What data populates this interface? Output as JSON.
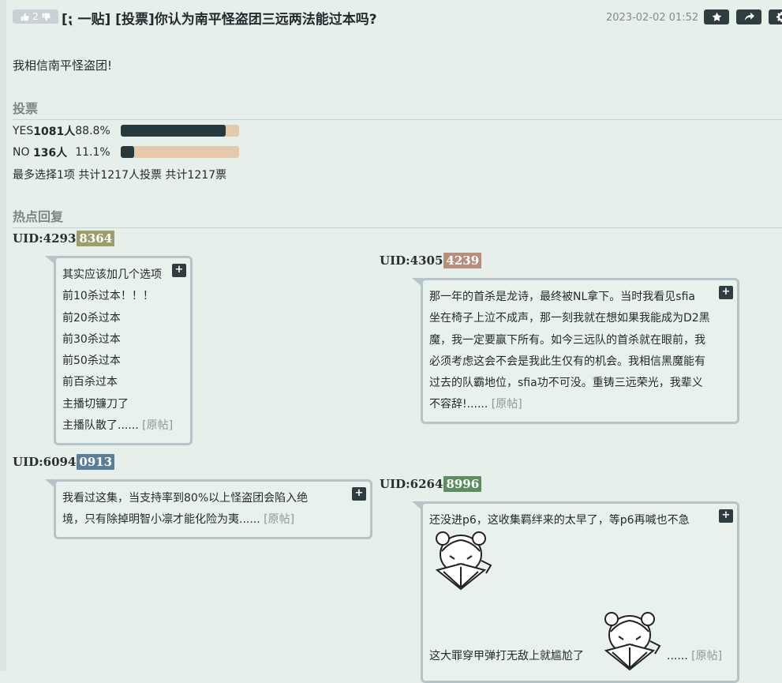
{
  "header": {
    "like_count": "2",
    "title": "[⁏ 一贴] [投票]你认为南平怪盗团三远两法能过本吗?",
    "timestamp": "2023-02-02 01:52"
  },
  "post": {
    "body": "我相信南平怪盗团!"
  },
  "vote": {
    "section_title": "投票",
    "options": [
      {
        "label": "YES",
        "count": "1081人",
        "percent": "88.8%",
        "fraction": 0.888
      },
      {
        "label": "NO ",
        "count": "136人",
        "percent": "11.1%",
        "fraction": 0.111
      }
    ],
    "summary": "最多选择1项 共计1217人投票 共计1217票"
  },
  "hot_replies": {
    "section_title": "热点回复",
    "original_label": "[原帖]",
    "replies": [
      {
        "uid_prefix": "UID:4293",
        "uid_tag": "8364",
        "tag_color": "#9c9c6c",
        "lines": [
          "其实应该加几个选项",
          "前10杀过本！！！",
          "前20杀过本",
          "前30杀过本",
          "前50杀过本",
          "前百杀过本",
          "主播切镰刀了",
          "主播队散了......"
        ]
      },
      {
        "uid_prefix": "UID:4305",
        "uid_tag": "4239",
        "tag_color": "#b78e7d",
        "lines": [
          "那一年的首杀是龙诗，最终被NL拿下。当时我看见sfia",
          "坐在椅子上泣不成声，那一刻我就在想如果我能成为D2黑",
          "魔，我一定要赢下所有。如今三远队的首杀就在眼前，我",
          "必须考虑这会不会是我此生仅有的机会。我相信黑魔能有",
          "过去的队霸地位，sfia功不可没。重铸三远荣光，我辈义",
          "不容辞!......"
        ]
      },
      {
        "uid_prefix": "UID:6094",
        "uid_tag": "0913",
        "tag_color": "#5b7f97",
        "lines": [
          "我看过这集，当支持率到80%以上怪盗团会陷入绝",
          "境，只有除掉明智小凛才能化险为夷......"
        ]
      },
      {
        "uid_prefix": "UID:6264",
        "uid_tag": "8996",
        "tag_color": "#5e8d64",
        "lines": [
          "还没进p6，这收集羁绊来的太早了，等p6再喊也不急",
          "这大罪穿甲弹打无敌上就尴尬了",
          "......"
        ]
      }
    ]
  },
  "buttons": {
    "plus_label": "+"
  },
  "colors": {
    "bar_fill": "#263a3e",
    "bar_bg": "#e5c9ab",
    "bubble_border": "#b4c4c9"
  }
}
